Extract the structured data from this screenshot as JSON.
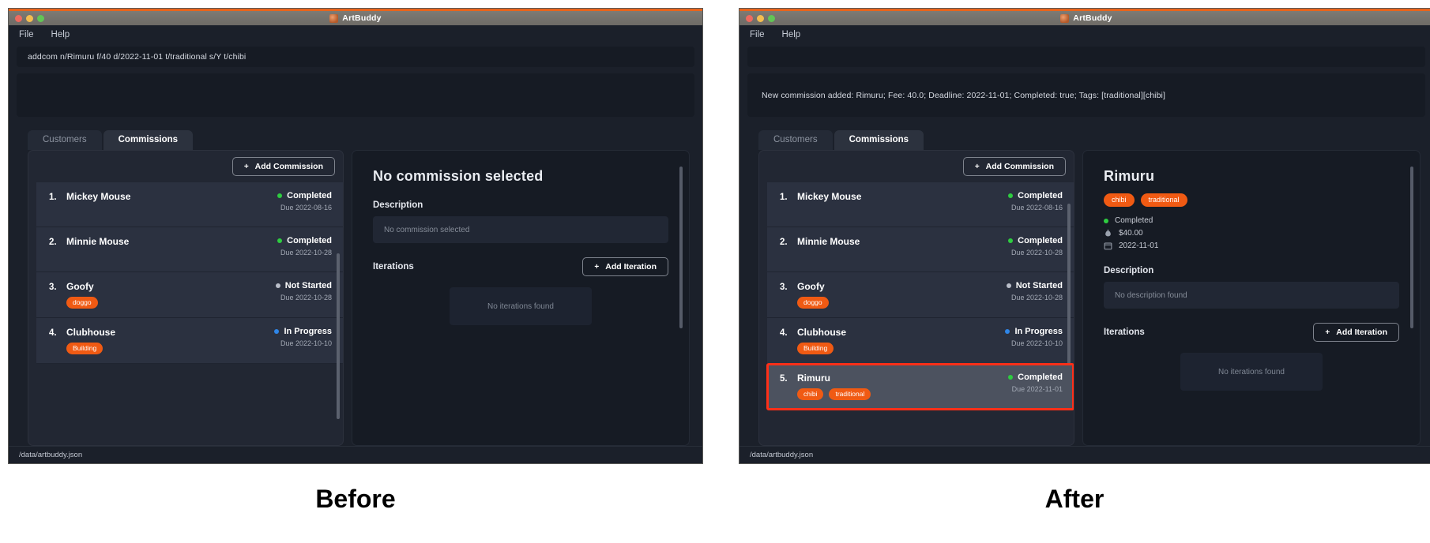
{
  "captions": {
    "before": "Before",
    "after": "After"
  },
  "window": {
    "title": "ArtBuddy",
    "menu": [
      "File",
      "Help"
    ],
    "statusbar_path": "/data/artbuddy.json"
  },
  "tabs": [
    {
      "label": "Customers",
      "active": false
    },
    {
      "label": "Commissions",
      "active": true
    }
  ],
  "buttons": {
    "add_commission": "Add Commission",
    "add_iteration": "Add Iteration",
    "plus": "+"
  },
  "before": {
    "command_input": "addcom n/Rimuru f/40 d/2022-11-01 t/traditional s/Y t/chibi",
    "result_text": "",
    "commissions": [
      {
        "index": "1.",
        "name": "Mickey Mouse",
        "tags": [],
        "status": "Completed",
        "status_color": "#2ecc40",
        "due": "Due 2022-08-16",
        "highlight": false
      },
      {
        "index": "2.",
        "name": "Minnie Mouse",
        "tags": [],
        "status": "Completed",
        "status_color": "#2ecc40",
        "due": "Due 2022-10-28",
        "highlight": false
      },
      {
        "index": "3.",
        "name": "Goofy",
        "tags": [
          "doggo"
        ],
        "status": "Not Started",
        "status_color": "#b9bec9",
        "due": "Due 2022-10-28",
        "highlight": false
      },
      {
        "index": "4.",
        "name": "Clubhouse",
        "tags": [
          "Building"
        ],
        "status": "In Progress",
        "status_color": "#2f86e8",
        "due": "Due 2022-10-10",
        "highlight": false
      }
    ],
    "detail": {
      "title": "No commission selected",
      "tags": [],
      "status": "",
      "fee": "",
      "deadline": "",
      "description_label": "Description",
      "description_value": "No commission selected",
      "iterations_label": "Iterations",
      "iterations_empty": "No iterations found"
    }
  },
  "after": {
    "command_input": "",
    "result_text": "New commission added: Rimuru; Fee: 40.0; Deadline: 2022-11-01; Completed: true; Tags: [traditional][chibi]",
    "commissions": [
      {
        "index": "1.",
        "name": "Mickey Mouse",
        "tags": [],
        "status": "Completed",
        "status_color": "#2ecc40",
        "due": "Due 2022-08-16",
        "highlight": false
      },
      {
        "index": "2.",
        "name": "Minnie Mouse",
        "tags": [],
        "status": "Completed",
        "status_color": "#2ecc40",
        "due": "Due 2022-10-28",
        "highlight": false
      },
      {
        "index": "3.",
        "name": "Goofy",
        "tags": [
          "doggo"
        ],
        "status": "Not Started",
        "status_color": "#b9bec9",
        "due": "Due 2022-10-28",
        "highlight": false
      },
      {
        "index": "4.",
        "name": "Clubhouse",
        "tags": [
          "Building"
        ],
        "status": "In Progress",
        "status_color": "#2f86e8",
        "due": "Due 2022-10-10",
        "highlight": false
      },
      {
        "index": "5.",
        "name": "Rimuru",
        "tags": [
          "chibi",
          "traditional"
        ],
        "status": "Completed",
        "status_color": "#2ecc40",
        "due": "Due 2022-11-01",
        "highlight": true
      }
    ],
    "detail": {
      "title": "Rimuru",
      "tags": [
        "chibi",
        "traditional"
      ],
      "status": "Completed",
      "status_color": "#2ecc40",
      "fee": "$40.00",
      "deadline": "2022-11-01",
      "description_label": "Description",
      "description_value": "No description found",
      "iterations_label": "Iterations",
      "iterations_empty": "No iterations found"
    }
  },
  "icons": {
    "money_bag": "money-bag-icon",
    "calendar": "calendar-icon"
  },
  "colors": {
    "accent_orange": "#f05a13",
    "title_accent": "#e8641c",
    "highlight_border": "#ff2f18",
    "completed": "#2ecc40",
    "in_progress": "#2f86e8",
    "not_started": "#b9bec9"
  }
}
